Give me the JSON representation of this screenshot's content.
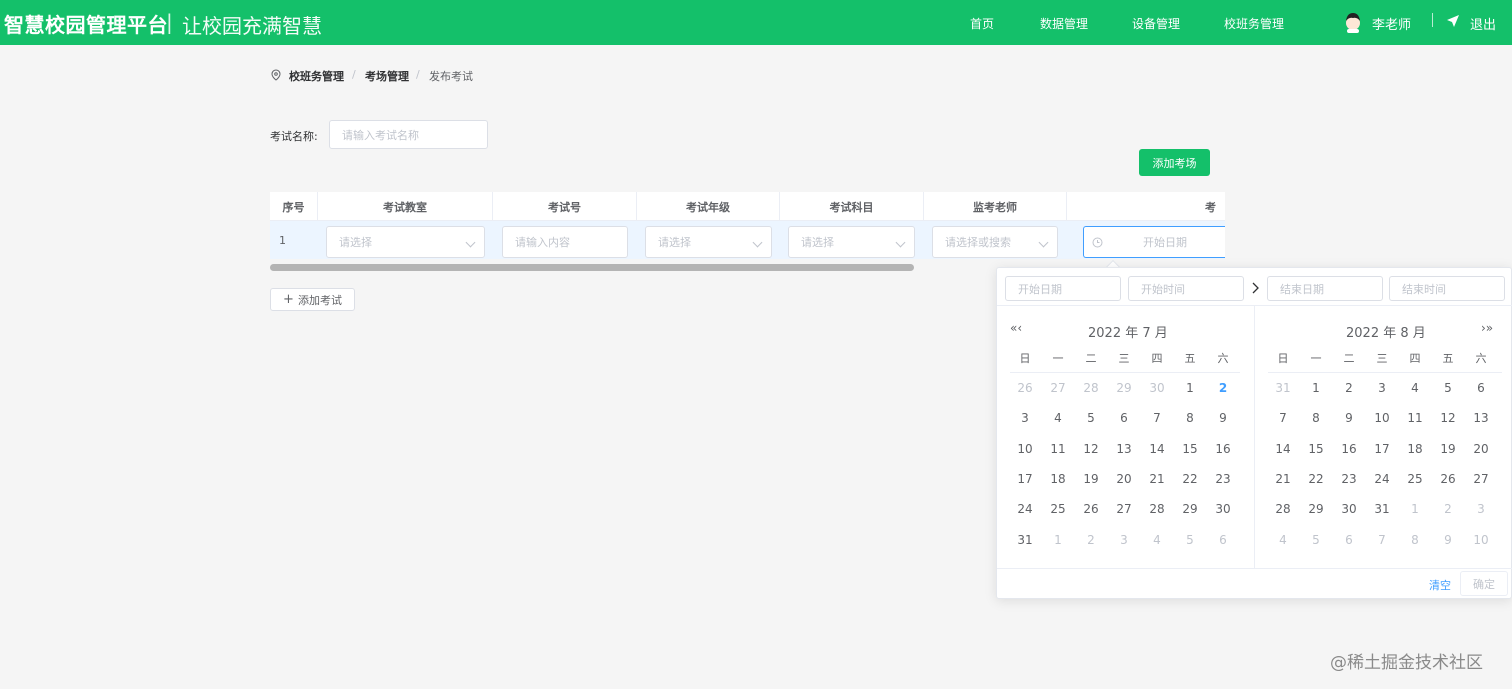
{
  "header": {
    "brand": "智慧校园管理平台",
    "separator": "|",
    "slogan": "让校园充满智慧",
    "nav": [
      "首页",
      "数据管理",
      "设备管理",
      "校班务管理"
    ],
    "user": "李老师",
    "logout": "退出",
    "bg_color": "#14c06a"
  },
  "breadcrumb": {
    "icon": "location-icon",
    "items": [
      "校班务管理",
      "考场管理",
      "发布考试"
    ],
    "separator": "/"
  },
  "form": {
    "exam_name_label": "考试名称:",
    "exam_name_placeholder": "请输入考试名称",
    "add_room_button": "添加考场"
  },
  "table": {
    "columns": [
      "序号",
      "考试教室",
      "考试号",
      "考试年级",
      "考试科目",
      "监考老师",
      "考"
    ],
    "row": {
      "index": "1",
      "room_placeholder": "请选择",
      "number_placeholder": "请输入内容",
      "grade_placeholder": "请选择",
      "subject_placeholder": "请选择",
      "teacher_placeholder": "请选择或搜索",
      "date_placeholder": "开始日期"
    }
  },
  "add_exam_button": "添加考试",
  "picker": {
    "start_date_placeholder": "开始日期",
    "start_time_placeholder": "开始时间",
    "end_date_placeholder": "结束日期",
    "end_time_placeholder": "结束时间",
    "left_nav": "«‹",
    "right_nav": "›»",
    "left_title": "2022 年 7 月",
    "right_title": "2022 年 8 月",
    "weekdays": [
      "日",
      "一",
      "二",
      "三",
      "四",
      "五",
      "六"
    ],
    "left_days": [
      [
        "26",
        "27",
        "28",
        "29",
        "30",
        "1",
        "2"
      ],
      [
        "3",
        "4",
        "5",
        "6",
        "7",
        "8",
        "9"
      ],
      [
        "10",
        "11",
        "12",
        "13",
        "14",
        "15",
        "16"
      ],
      [
        "17",
        "18",
        "19",
        "20",
        "21",
        "22",
        "23"
      ],
      [
        "24",
        "25",
        "26",
        "27",
        "28",
        "29",
        "30"
      ],
      [
        "31",
        "1",
        "2",
        "3",
        "4",
        "5",
        "6"
      ]
    ],
    "right_days": [
      [
        "31",
        "1",
        "2",
        "3",
        "4",
        "5",
        "6"
      ],
      [
        "7",
        "8",
        "9",
        "10",
        "11",
        "12",
        "13"
      ],
      [
        "14",
        "15",
        "16",
        "17",
        "18",
        "19",
        "20"
      ],
      [
        "21",
        "22",
        "23",
        "24",
        "25",
        "26",
        "27"
      ],
      [
        "28",
        "29",
        "30",
        "31",
        "1",
        "2",
        "3"
      ],
      [
        "4",
        "5",
        "6",
        "7",
        "8",
        "9",
        "10"
      ]
    ],
    "today": "2",
    "clear": "清空",
    "confirm": "确定"
  },
  "watermark": "@稀土掘金技术社区"
}
